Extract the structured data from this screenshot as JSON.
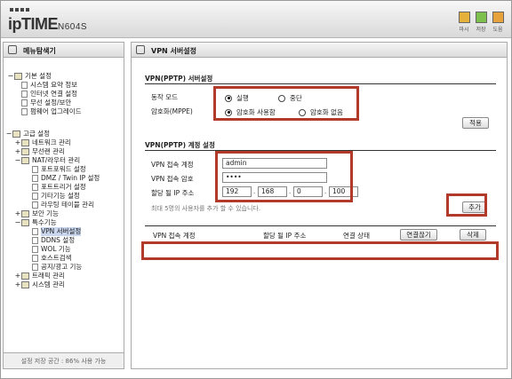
{
  "app": {
    "logo_main": "ipTIME",
    "logo_model": "N604S"
  },
  "header_buttons": [
    {
      "label": "마시"
    },
    {
      "label": "저장"
    },
    {
      "label": "도움"
    }
  ],
  "left": {
    "title": "메뉴탐색기",
    "items": [
      {
        "label": "기본 설정"
      },
      {
        "label": "시스템 요약 정보"
      },
      {
        "label": "인터넷 연결 설정"
      },
      {
        "label": "무선 설정/보안"
      },
      {
        "label": "펌웨어 업그레이드"
      },
      {
        "label": "고급 설정"
      },
      {
        "label": "네트워크 관리"
      },
      {
        "label": "무선랜 관리"
      },
      {
        "label": "NAT/라우터 관리"
      },
      {
        "label": "포트포워드 설정"
      },
      {
        "label": "DMZ / Twin IP 설정"
      },
      {
        "label": "포트트리거 설정"
      },
      {
        "label": "기타기능 설정"
      },
      {
        "label": "라우팅 테이블 관리"
      },
      {
        "label": "보안 기능"
      },
      {
        "label": "특수기능"
      },
      {
        "label": "VPN 서버설정"
      },
      {
        "label": "DDNS 설정"
      },
      {
        "label": "WOL 기능"
      },
      {
        "label": "호스트검색"
      },
      {
        "label": "공지/광고 기능"
      },
      {
        "label": "트래픽 관리"
      },
      {
        "label": "시스템 관리"
      }
    ],
    "footer": "설정 저장 공간 : 86% 사용 가능"
  },
  "main": {
    "title": "VPN 서버설정",
    "server_section": "VPN(PPTP) 서버설정",
    "mode_label": "동작 모드",
    "mode_options": [
      "실행",
      "중단"
    ],
    "encrypt_label": "암호화(MPPE)",
    "encrypt_options": [
      "암호화 사용함",
      "암호화 없음"
    ],
    "apply_label": "적용",
    "account_section": "VPN(PPTP) 계정 설정",
    "account_label": "VPN 접속 계정",
    "account_value": "admin",
    "password_label": "VPN 접속 암호",
    "password_value": "••••",
    "ip_label": "할당 될 IP 주소",
    "ip": [
      "192",
      "168",
      "0",
      "100"
    ],
    "note": "최대 5명의 사용자를 추가 할 수 있습니다.",
    "add_label": "추가",
    "table_headers": [
      "VPN 접속 계정",
      "할당 될 IP 주소",
      "연결 상태",
      "연결끊기",
      "삭제"
    ]
  },
  "colors": {
    "highlight_box": "#b23a2b"
  }
}
